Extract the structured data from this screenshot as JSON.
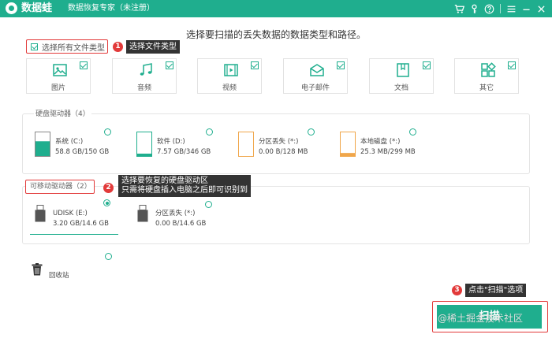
{
  "window": {
    "app_name": "数据蛙",
    "subtitle": "数据恢复专家（未注册）",
    "icons": [
      "cart-icon",
      "key-icon",
      "help-icon",
      "menu-icon",
      "minimize-icon",
      "close-icon"
    ]
  },
  "heading": "选择要扫描的丢失数据的数据类型和路径。",
  "select_all": {
    "label": "选择所有文件类型",
    "checked": true
  },
  "annotations": {
    "a1": {
      "number": "1",
      "text": "选择文件类型"
    },
    "a2": {
      "number": "2",
      "line1": "选择要恢复的硬盘驱动区",
      "line2": "只需将硬盘插入电脑之后即可识别到"
    },
    "a3": {
      "number": "3",
      "text": "点击\"扫描\"选项"
    }
  },
  "file_types": [
    {
      "label": "图片",
      "icon": "image-icon",
      "checked": true
    },
    {
      "label": "音频",
      "icon": "music-icon",
      "checked": true
    },
    {
      "label": "视频",
      "icon": "video-icon",
      "checked": true
    },
    {
      "label": "电子邮件",
      "icon": "email-icon",
      "checked": true
    },
    {
      "label": "文档",
      "icon": "document-icon",
      "checked": true
    },
    {
      "label": "其它",
      "icon": "other-icon",
      "checked": true
    }
  ],
  "hard_drives": {
    "title": "硬盘驱动器（4）",
    "items": [
      {
        "name": "系统 (C:)",
        "size": "58.8 GB/150 GB",
        "fill": 0.39,
        "color": "#1fae8e",
        "selected": false
      },
      {
        "name": "软件 (D:)",
        "size": "7.57 GB/346 GB",
        "fill": 0.02,
        "color": "#1fae8e",
        "selected": false
      },
      {
        "name": "分区丢失 (*:)",
        "size": "0.00  B/128 MB",
        "fill": 0.0,
        "color": "#f0a64a",
        "selected": false
      },
      {
        "name": "本地磁盘 (*:)",
        "size": "25.3 MB/299 MB",
        "fill": 0.08,
        "color": "#f0a64a",
        "selected": false
      }
    ]
  },
  "removable": {
    "title": "可移动驱动器（2）",
    "items": [
      {
        "name": "UDISK (E:)",
        "size": "3.20 GB/14.6 GB",
        "selected": true
      },
      {
        "name": "分区丢失 (*:)",
        "size": "0.00  B/14.6 GB",
        "selected": false
      }
    ]
  },
  "recycle_bin": {
    "label": "回收站",
    "selected": false
  },
  "scan_button": {
    "label": "扫描"
  },
  "watermark": "@稀土掘金技术社区",
  "colors": {
    "accent": "#1fae8e",
    "annotation": "#e23a3a",
    "tooltip_bg": "#333333",
    "lost_partition": "#f0a64a"
  }
}
